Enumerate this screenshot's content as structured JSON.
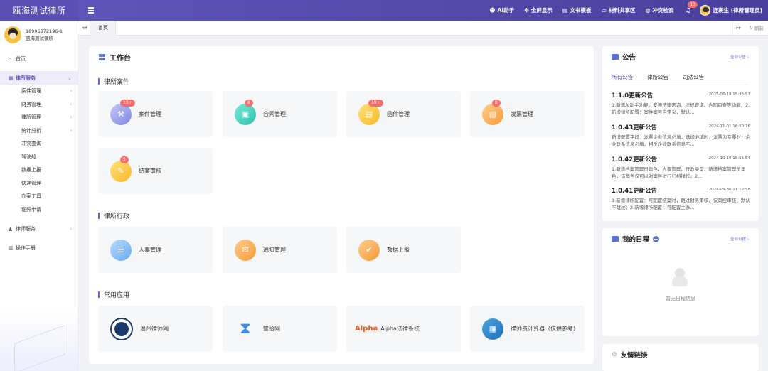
{
  "app": {
    "title": "瓯海测试律所"
  },
  "topnav": [
    {
      "label": "AI助手",
      "icon": "robot-icon"
    },
    {
      "label": "全屏显示",
      "icon": "fullscreen-icon"
    },
    {
      "label": "文书模板",
      "icon": "document-icon"
    },
    {
      "label": "材料共享区",
      "icon": "folder-icon"
    },
    {
      "label": "冲突检索",
      "icon": "globe-icon"
    }
  ],
  "notifications": {
    "count": "13"
  },
  "user": {
    "name": "连裹生 (律所管理员)",
    "phone": "18906872196-1",
    "firm": "瓯海测试律所"
  },
  "sidebar": {
    "home": "首页",
    "firm_service": "律所服务",
    "sub_items": [
      "案件管理",
      "财务管理",
      "律所管理",
      "统计分析",
      "冲突查询",
      "驾驶舱",
      "数据上报",
      "快递管理",
      "办案工具",
      "证照申请"
    ],
    "lawyer_service": "律师服务",
    "manual": "操作手册"
  },
  "tabs": {
    "home": "首页",
    "refresh": "刷新"
  },
  "workbench": {
    "title": "工作台",
    "sections": {
      "cases": "律所案件",
      "admin": "律所行政",
      "apps": "常用应用"
    },
    "case_cards": [
      {
        "label": "案件管理",
        "badge": "10+"
      },
      {
        "label": "合同管理",
        "badge": "8"
      },
      {
        "label": "函件管理",
        "badge": "10+"
      },
      {
        "label": "发票管理",
        "badge": "8"
      },
      {
        "label": "结案审核",
        "badge": "5"
      }
    ],
    "admin_cards": [
      {
        "label": "人事管理"
      },
      {
        "label": "通知管理"
      },
      {
        "label": "数据上报"
      }
    ],
    "app_cards": [
      {
        "label": "温州律师网"
      },
      {
        "label": "智拾网"
      },
      {
        "label": "Alpha法律系统",
        "logo": "Alpha"
      },
      {
        "label": "律师费计算器（仅供参考）"
      }
    ]
  },
  "announcements": {
    "title": "公告",
    "more": "全部公告",
    "tabs": [
      "所有公告",
      "律所公告",
      "司法公告"
    ],
    "items": [
      {
        "title": "1.1.0更新公告",
        "date": "2025-06-19 15:35:57",
        "body": "1.新增AI助手功能，支持法律咨询、法规查询、合同审查等功能；2.新增律所配置：案件案号自定义，默认..."
      },
      {
        "title": "1.0.43更新公告",
        "date": "2024-11-01 16:50:16",
        "body": "新增配置字段：发票企业信息必填，选择必填时，发票为专票时，企业联系信息必填，相反企业联系信息不..."
      },
      {
        "title": "1.0.42更新公告",
        "date": "2024-10-10 15:55:54",
        "body": "1.新增档案管理员角色，人事管理，行政类型，新增档案管理员角色，该角色仅可以对案件进行归档操作。2..."
      },
      {
        "title": "1.0.41更新公告",
        "date": "2024-09-30 11:12:58",
        "body": "1.新增律所配置：可配置结案时，跳过财务审核，仅风控审核，默认不跳过；2.新增律所配置：可配置主办..."
      }
    ]
  },
  "schedule": {
    "title": "我的日程",
    "more": "全部日程",
    "empty": "暂无日程信息"
  },
  "links": {
    "title": "友情链接"
  }
}
